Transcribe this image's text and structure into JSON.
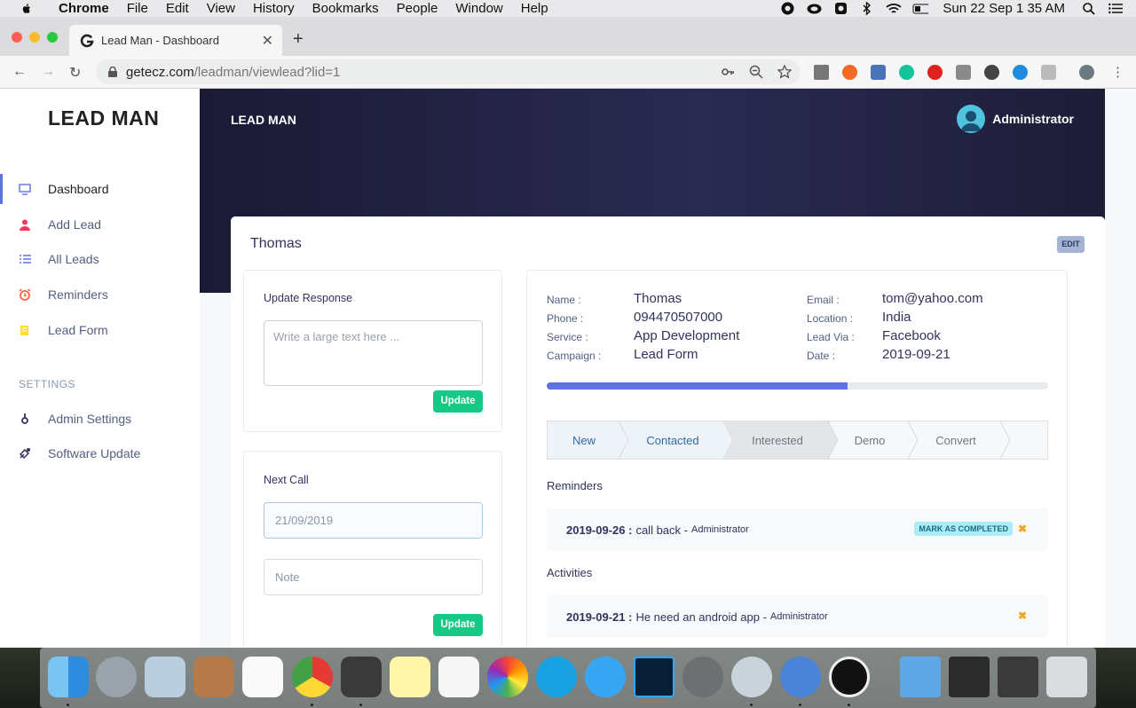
{
  "menubar": {
    "app": "Chrome",
    "items": [
      "File",
      "Edit",
      "View",
      "History",
      "Bookmarks",
      "People",
      "Window",
      "Help"
    ],
    "clock": "Sun 22 Sep  1 35 AM"
  },
  "browser": {
    "tab_title": "Lead Man - Dashboard",
    "url_host": "getecz.com",
    "url_path": "/leadman/viewlead?lid=1"
  },
  "sidebar": {
    "logo": "LEAD MAN",
    "items": [
      {
        "label": "Dashboard",
        "icon": "monitor-icon"
      },
      {
        "label": "Add Lead",
        "icon": "user-icon"
      },
      {
        "label": "All Leads",
        "icon": "list-icon"
      },
      {
        "label": "Reminders",
        "icon": "alarm-icon"
      },
      {
        "label": "Lead Form",
        "icon": "form-icon"
      }
    ],
    "settings_heading": "SETTINGS",
    "settings_items": [
      {
        "label": "Admin Settings",
        "icon": "settings-icon"
      },
      {
        "label": "Software Update",
        "icon": "update-icon"
      }
    ]
  },
  "header": {
    "brand": "LEAD MAN",
    "user": "Administrator"
  },
  "lead": {
    "name": "Thomas",
    "edit_label": "EDIT",
    "details_left": [
      {
        "label": "Name :",
        "value": "Thomas"
      },
      {
        "label": "Phone :",
        "value": "094470507000"
      },
      {
        "label": "Service :",
        "value": "App Development"
      },
      {
        "label": "Campaign :",
        "value": "Lead Form"
      }
    ],
    "details_right": [
      {
        "label": "Email :",
        "value": "tom@yahoo.com"
      },
      {
        "label": "Location :",
        "value": "India"
      },
      {
        "label": "Lead Via :",
        "value": "Facebook"
      },
      {
        "label": "Date :",
        "value": "2019-09-21"
      }
    ],
    "progress_fraction": 0.6,
    "stages": [
      "New",
      "Contacted",
      "Interested",
      "Demo",
      "Convert"
    ]
  },
  "response": {
    "title": "Update Response",
    "placeholder": "Write a large text here ...",
    "button": "Update"
  },
  "next_call": {
    "title": "Next Call",
    "date": "21/09/2019",
    "note_placeholder": "Note",
    "button": "Update"
  },
  "reminders": {
    "heading": "Reminders",
    "items": [
      {
        "date": "2019-09-26 :",
        "text": "call back -",
        "by": "Administrator",
        "badge": "MARK AS COMPLETED"
      }
    ]
  },
  "activities": {
    "heading": "Activities",
    "items": [
      {
        "date": "2019-09-21 :",
        "text": "He need an android app -",
        "by": "Administrator"
      }
    ]
  }
}
